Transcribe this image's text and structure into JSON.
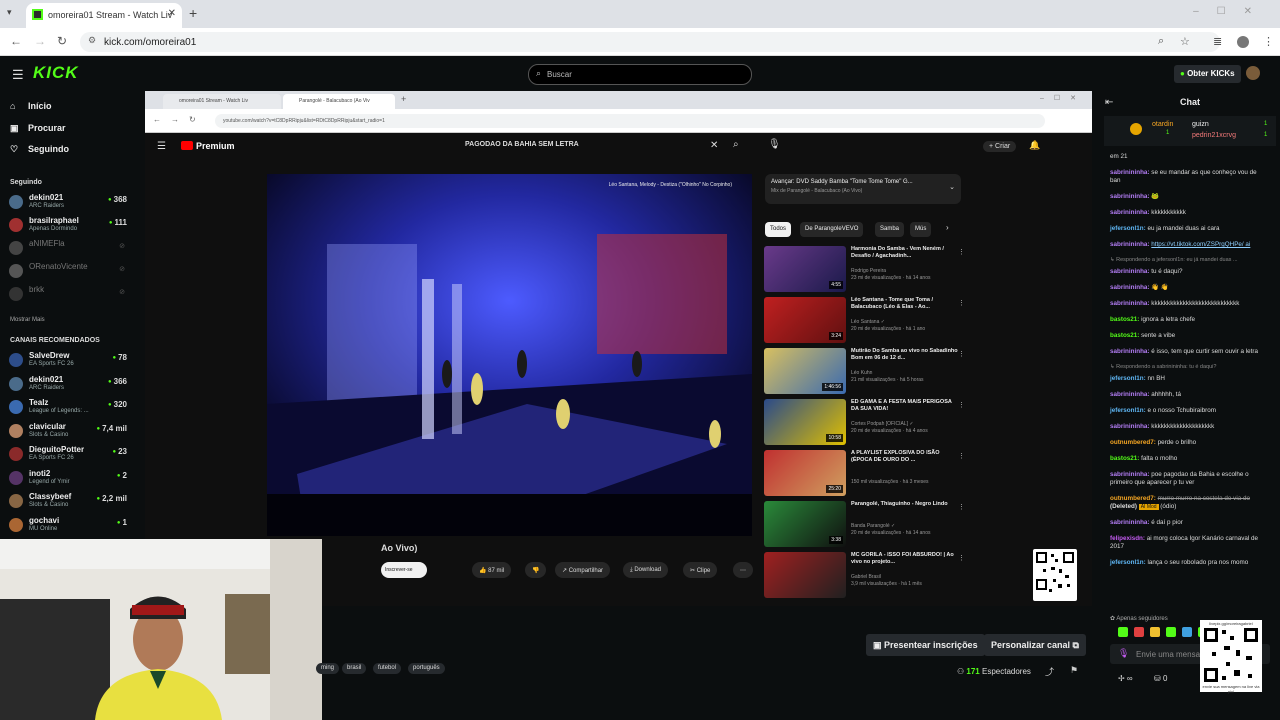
{
  "browser": {
    "tab_title": "omoreira01 Stream - Watch Liv",
    "url": "kick.com/omoreira01"
  },
  "kick": {
    "logo": "KICK",
    "search_placeholder": "Buscar",
    "get_kicks": "Obter KICKs",
    "nav": [
      {
        "label": "Início",
        "icon": "⌂"
      },
      {
        "label": "Procurar",
        "icon": "▣"
      },
      {
        "label": "Seguindo",
        "icon": "♡"
      }
    ],
    "following_header": "Seguindo",
    "following": [
      {
        "name": "dekin021",
        "sub": "ARC Raiders",
        "count": "368",
        "online": true,
        "color": "#4a6b8a"
      },
      {
        "name": "brasilraphael",
        "sub": "Apenas Dormindo",
        "count": "111",
        "online": true,
        "color": "#a03030"
      },
      {
        "name": "aNIMEFla",
        "sub": "",
        "count": "",
        "online": false,
        "color": "#444"
      },
      {
        "name": "ORenatoVicente",
        "sub": "",
        "count": "",
        "online": false,
        "color": "#555"
      },
      {
        "name": "brkk",
        "sub": "",
        "count": "",
        "online": false,
        "color": "#333"
      }
    ],
    "show_more": "Mostrar Mais",
    "recommended_header": "CANAIS RECOMENDADOS",
    "recommended": [
      {
        "name": "SalveDrew",
        "sub": "EA Sports FC 26",
        "count": "78",
        "color": "#2d4d8a"
      },
      {
        "name": "dekin021",
        "sub": "ARC Raiders",
        "count": "366",
        "color": "#4a6b8a"
      },
      {
        "name": "Tealz",
        "sub": "League of Legends: ...",
        "count": "320",
        "color": "#3a6ab0"
      },
      {
        "name": "clavicular",
        "sub": "Slots & Casino",
        "count": "7,4 mil",
        "color": "#b08060"
      },
      {
        "name": "DieguitoPotter",
        "sub": "EA Sports FC 26",
        "count": "23",
        "color": "#8a2a2a"
      },
      {
        "name": "inoti2",
        "sub": "Legend of Ymir",
        "count": "2",
        "color": "#553366"
      },
      {
        "name": "Classybeef",
        "sub": "Slots & Casino",
        "count": "2,2 mil",
        "color": "#886644"
      },
      {
        "name": "gochavi",
        "sub": "MU Online",
        "count": "1",
        "color": "#aa6633"
      }
    ]
  },
  "inner": {
    "tab1": "omoreira01 Stream - Watch Liv",
    "tab2": "Parangolé - Balacubaco (Ao Viv",
    "url": "youtube.com/watch?v=tC8DpRRipju&list=RDtC8DpRRipju&start_radio=1",
    "yt_logo": "Premium",
    "yt_search": "PAGODAO DA BAHIA SEM LETRA",
    "create": "+ Criar",
    "video_overlay": "Léo Santana, Melody - Destiza (\"Olhinho\" No Corpinho)",
    "video_title_fragment": "Ao Vivo)",
    "subscribe": "Inscrever-se",
    "actions": [
      {
        "label": "👍 87 mil"
      },
      {
        "label": "👎"
      },
      {
        "label": "↗ Compartilhar"
      },
      {
        "label": "⤓ Download"
      },
      {
        "label": "✂ Clipe"
      },
      {
        "label": "⋯"
      }
    ],
    "mix_next": "Avançar: DVD Saddy Bamba \"Tome Tome Tome\" G...",
    "mix_sub": "Mix de Parangolé - Balacubaco (Ao Vivo)",
    "chips": [
      "Todos",
      "De ParangoleVEVO",
      "Samba",
      "Mús"
    ],
    "recs": [
      {
        "title": "Harmonia Do Samba - Vem Neném / Desafio / Agachadinh...",
        "channel": "Rodrigo Pereira",
        "views": "23 mi de visualizações · há 14 anos",
        "dur": "4:55",
        "c1": "#6a3a8a",
        "c2": "#1a1a4a"
      },
      {
        "title": "Léo Santana - Tome que Toma / Balacubaco (Léo & Elas - Ao...",
        "channel": "Léo Santana ✓",
        "views": "20 mi de visualizações · há 1 ano",
        "dur": "3:24",
        "c1": "#c02020",
        "c2": "#601010"
      },
      {
        "title": "Mutirão Do Samba ao vivo no Sabadinho Bom em 06 de 12 d...",
        "channel": "Léo Kuhn",
        "views": "21 mil visualizações · há 5 horas",
        "dur": "1:46:56",
        "c1": "#d8c060",
        "c2": "#3a6ab0"
      },
      {
        "title": "ED GAMA E A FESTA MAIS PERIGOSA DA SUA VIDA!",
        "channel": "Cortes Podpah [OFICIAL] ✓",
        "views": "20 mi de visualizações · há 4 anos",
        "dur": "10:58",
        "c1": "#2a4a8a",
        "c2": "#e0c000"
      },
      {
        "title": "A PLAYLIST EXPLOSIVA DO ISÃO (ÉPOCA DE OURO DO ...",
        "channel": "",
        "views": "150 mil visualizações · há 3 meses",
        "dur": "25:20",
        "c1": "#c03030",
        "c2": "#d0a060"
      },
      {
        "title": "Parangolé, Thiaguinho - Negro Lindo",
        "channel": "Banda Parangolé ✓",
        "views": "20 mi de visualizações · há 14 anos",
        "dur": "3:38",
        "c1": "#2a8a3a",
        "c2": "#101010"
      },
      {
        "title": "MC GORILA - ISSO FOI ABSURDO! | Ao vivo no projeto...",
        "channel": "Gabriel Brasil",
        "views": "3,9 mil visualizações · há 1 mês",
        "dur": "",
        "c1": "#a02020",
        "c2": "#202020"
      }
    ]
  },
  "below": {
    "present_btn": "Presentear inscrições",
    "customize_btn": "Personalizar canal",
    "tags": [
      "ming",
      "brasil",
      "futebol",
      "português"
    ],
    "viewers_count": "171",
    "viewers_label": "Espectadores"
  },
  "chat": {
    "title": "Chat",
    "pinned": [
      {
        "user": "otardin",
        "rank": "1"
      },
      {
        "user": "guizn",
        "rank": "1"
      },
      {
        "user": "pedrin21xcrvg",
        "rank": "1"
      }
    ],
    "messages": [
      {
        "user": "",
        "text": "em 21",
        "color": "#ddd"
      },
      {
        "user": "sabrinininha:",
        "text": "se eu mandar as que conheço vou de ban",
        "color": "#b37df5"
      },
      {
        "user": "sabrinininha:",
        "text": "🐸",
        "color": "#b37df5"
      },
      {
        "user": "sabrinininha:",
        "text": "kkkkkkkkkkk",
        "color": "#b37df5"
      },
      {
        "user": "jefersonl1n:",
        "text": "eu ja mandei duas ai cara",
        "color": "#5fb7f5"
      },
      {
        "user": "sabrinininha:",
        "text": "https://vt.tiktok.com/ZSPrgQHPe/ ai",
        "color": "#b37df5",
        "link": true
      },
      {
        "reply": "↳ Respondendo a jefersonl1n: eu já mandei duas ..."
      },
      {
        "user": "sabrinininha:",
        "text": "tu é daqui?",
        "color": "#b37df5"
      },
      {
        "user": "sabrinininha:",
        "text": "👋 👋",
        "color": "#b37df5"
      },
      {
        "user": "sabrinininha:",
        "text": "kkkkkkkkkkkkkkkkkkkkkkkkkkkk",
        "color": "#b37df5"
      },
      {
        "user": "bastos21:",
        "text": "ignora a letra chefe",
        "color": "#53fc18"
      },
      {
        "user": "bastos21:",
        "text": "sente a vibe",
        "color": "#53fc18"
      },
      {
        "user": "sabrinininha:",
        "text": "é isso, tem que curtir sem ouvir a letra",
        "color": "#b37df5"
      },
      {
        "reply": "↳ Respondendo a sabrinininha: tu é daqui?"
      },
      {
        "user": "jefersonl1n:",
        "text": "nn BH",
        "color": "#5fb7f5"
      },
      {
        "user": "sabrinininha:",
        "text": "ahhhhh, tá",
        "color": "#b37df5"
      },
      {
        "user": "jefersonl1n:",
        "text": "e o nosso Tchubiraibrom",
        "color": "#5fb7f5"
      },
      {
        "user": "sabrinininha:",
        "text": "kkkkkkkkkkkkkkkkkkkk",
        "color": "#b37df5"
      },
      {
        "user": "outnumbered7:",
        "text": "perde o brilho",
        "color": "#f5a623"
      },
      {
        "user": "bastos21:",
        "text": "falta o molho",
        "color": "#53fc18"
      },
      {
        "user": "sabrinininha:",
        "text": "poe pagodao da Bahia e escolhe o primeiro que aparecer p tu ver",
        "color": "#b37df5"
      },
      {
        "user": "outnumbered7:",
        "text": "murro murro na costela do via do",
        "color": "#f5a623",
        "strike": true
      },
      {
        "user": "sabrinininha:",
        "text": "é daí p pior",
        "color": "#b37df5"
      },
      {
        "user": "felipexisdn:",
        "text": "ai morg coloca Igor Kanário carnaval de 2017",
        "color": "#c45bf2"
      },
      {
        "user": "jefersonl1n:",
        "text": "lança o seu roboIado pra nos momo",
        "color": "#5fb7f5"
      }
    ],
    "deleted": "(Deleted)",
    "mod_tag": "AI Mod",
    "deleted_suffix": "(ódio)",
    "followers_only": "✿ Apenas seguidores",
    "input_placeholder": "Envie uma mensa",
    "bottom_left": "✢ ∞",
    "bottom_count": "0",
    "qr_top": "livepix.gg/moreiragabriel",
    "qr_text": "envie sua mensagem na live via pix!"
  }
}
